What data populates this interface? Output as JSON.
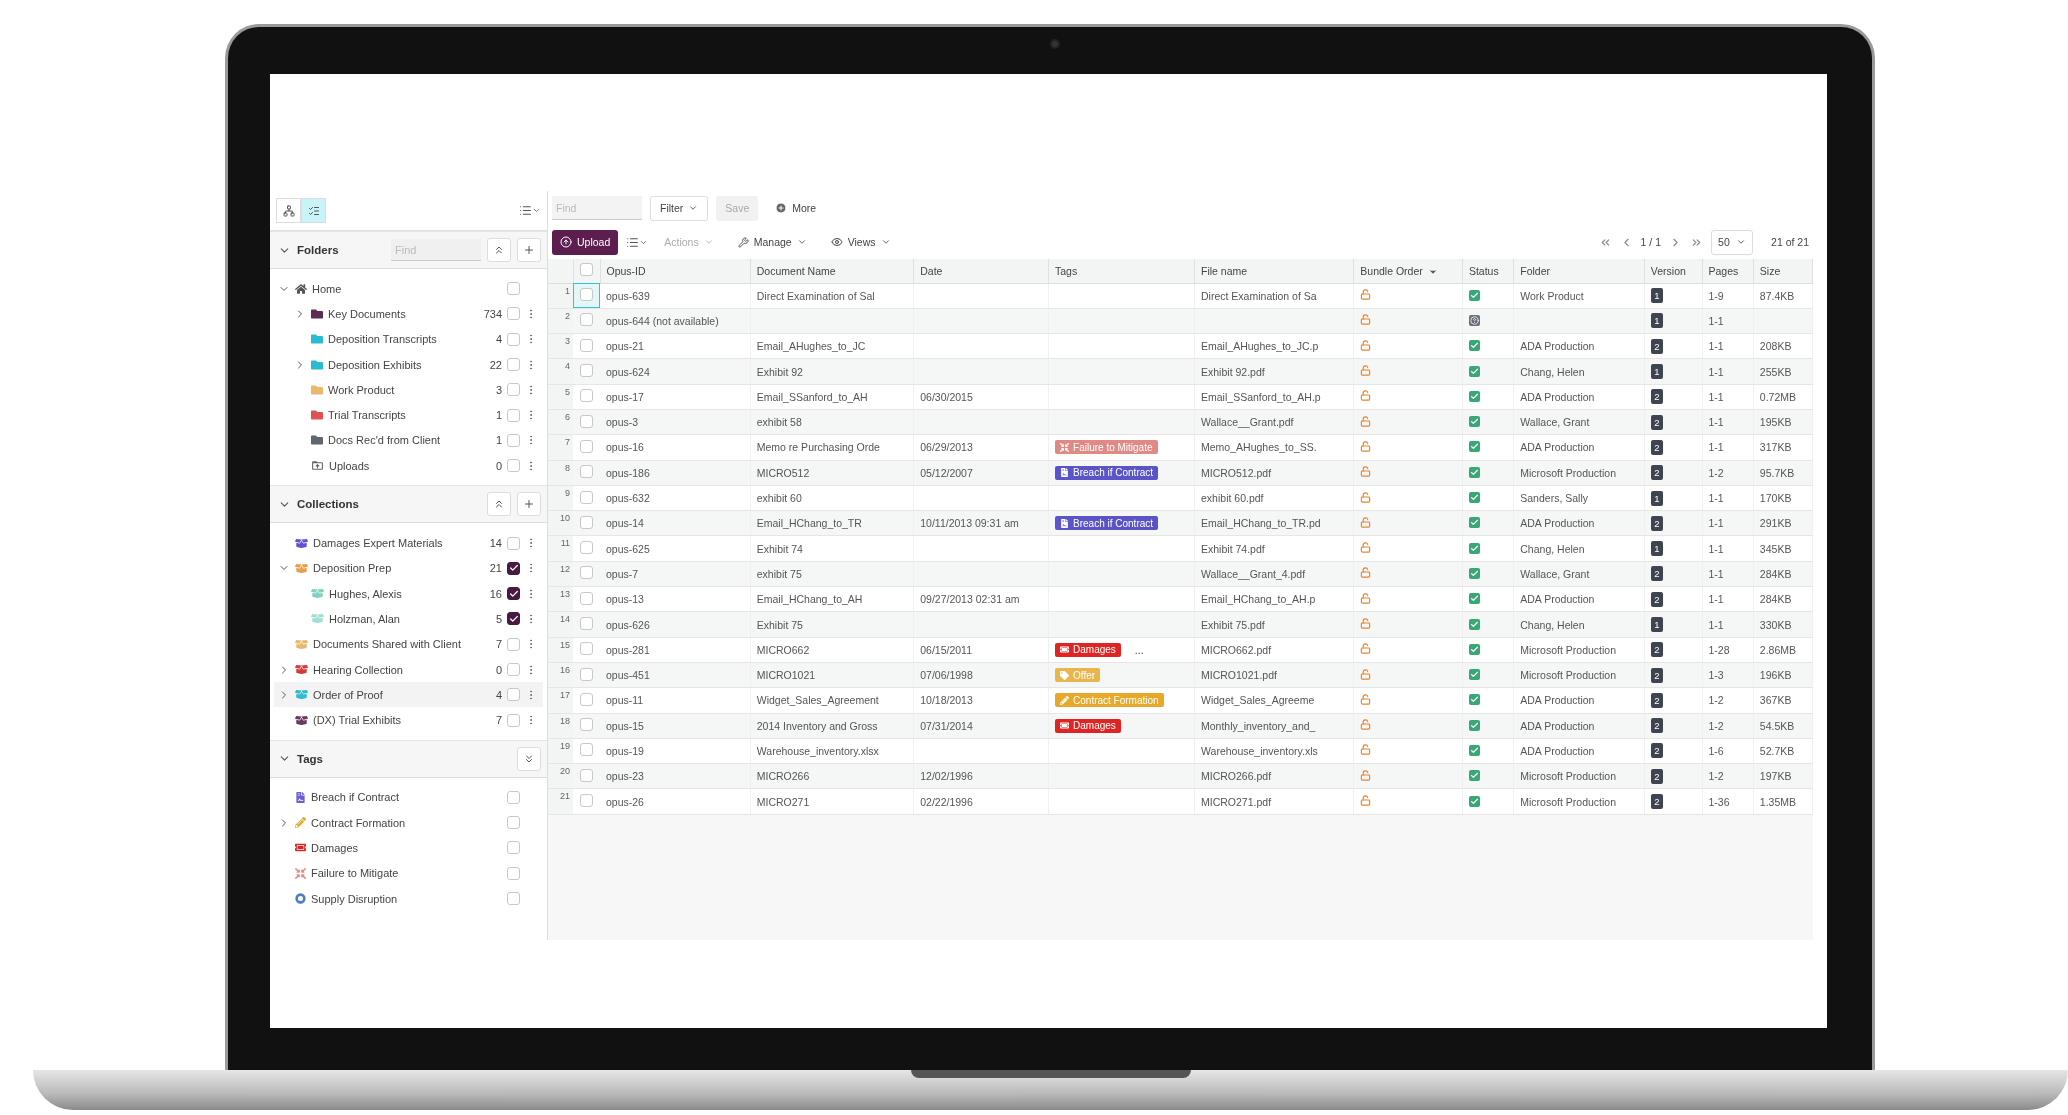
{
  "sidebar": {
    "view_buttons": [
      {
        "kind": "tree",
        "selected": false
      },
      {
        "kind": "list",
        "selected": true
      }
    ],
    "folders": {
      "title": "Folders",
      "expanded": true,
      "find_placeholder": "Find",
      "buttons": [
        {
          "kind": "collapse"
        },
        {
          "kind": "add"
        }
      ],
      "items": [
        {
          "label": "Home",
          "kind": "home",
          "expanded": true,
          "checked": false,
          "children": [
            {
              "label": "Key Documents",
              "kind": "folder",
              "color": "#5c2a55",
              "count": "734",
              "expanded": false,
              "checked": false
            },
            {
              "label": "Deposition Transcripts",
              "kind": "folder",
              "color": "#29bcd0",
              "count": "4",
              "checked": false
            },
            {
              "label": "Deposition Exhibits",
              "kind": "folder",
              "color": "#29bcd0",
              "count": "22",
              "expanded": false,
              "checked": false
            },
            {
              "label": "Work Product",
              "kind": "folder",
              "color": "#e8b96a",
              "count": "3",
              "checked": false
            },
            {
              "label": "Trial Transcripts",
              "kind": "folder",
              "color": "#e05252",
              "count": "1",
              "checked": false
            },
            {
              "label": "Docs Rec'd from Client",
              "kind": "folder",
              "color": "#5f6670",
              "count": "1",
              "checked": false
            },
            {
              "label": "Uploads",
              "kind": "upload",
              "color": "#5f6670",
              "count": "0",
              "checked": false
            }
          ]
        }
      ]
    },
    "collections": {
      "title": "Collections",
      "expanded": true,
      "buttons": [
        {
          "kind": "collapse"
        },
        {
          "kind": "add"
        }
      ],
      "items": [
        {
          "label": "Damages Expert Materials",
          "color": "#6a4fd0",
          "count": "14",
          "checked": false,
          "selected": false
        },
        {
          "label": "Deposition Prep",
          "color": "#e8a04a",
          "count": "21",
          "checked": true,
          "selected": false,
          "expanded": true,
          "children": [
            {
              "label": "Hughes, Alexis",
              "color": "#7fd3c1",
              "count": "16",
              "checked": true,
              "selected": false
            },
            {
              "label": "Holzman, Alan",
              "color": "#9fe0d5",
              "count": "5",
              "checked": true,
              "selected": false
            }
          ]
        },
        {
          "label": "Documents Shared with Client",
          "color": "#e8b96a",
          "count": "7",
          "checked": false,
          "selected": false
        },
        {
          "label": "Hearing Collection",
          "color": "#d83a3a",
          "count": "0",
          "checked": false,
          "selected": false,
          "expanded": false
        },
        {
          "label": "Order of Proof",
          "color": "#29bcd0",
          "count": "4",
          "checked": false,
          "selected": true,
          "expanded": false
        },
        {
          "label": "(DX) Trial Exhibits",
          "color": "#6b3a5e",
          "count": "7",
          "checked": false,
          "selected": false
        }
      ]
    },
    "tags": {
      "title": "Tags",
      "expanded": true,
      "buttons": [
        {
          "kind": "expand"
        }
      ],
      "items": [
        {
          "label": "Breach if Contract",
          "kind": "breach",
          "color": "#6a5fd0",
          "checked": false
        },
        {
          "label": "Contract Formation",
          "kind": "formation",
          "color": "#e8a92a",
          "checked": false,
          "expanded": false
        },
        {
          "label": "Damages",
          "kind": "damages",
          "color": "#e02424",
          "checked": false
        },
        {
          "label": "Failure to Mitigate",
          "kind": "mitigate",
          "color": "#e08a86",
          "checked": false
        },
        {
          "label": "Supply Disruption",
          "kind": "supply",
          "color": "#4a7fc0",
          "checked": false
        }
      ]
    }
  },
  "toolbar": {
    "find_placeholder": "Find",
    "filter": "Filter",
    "save": {
      "label": "Save",
      "disabled": true
    },
    "more": "More"
  },
  "actions_bar": {
    "upload": "Upload",
    "menus": [
      {
        "label": "Actions",
        "kind": "actions",
        "disabled": true
      },
      {
        "label": "Manage",
        "kind": "manage",
        "disabled": false
      },
      {
        "label": "Views",
        "kind": "views",
        "disabled": false
      }
    ]
  },
  "pagination": {
    "page": "1 / 1",
    "page_size": "50",
    "count": "21 of 21"
  },
  "table": {
    "select_all": {
      "checked": false
    },
    "columns": [
      {
        "label": "Opus-ID",
        "sorted": false
      },
      {
        "label": "Document Name",
        "sorted": false
      },
      {
        "label": "Date",
        "sorted": false
      },
      {
        "label": "Tags",
        "sorted": false
      },
      {
        "label": "File name",
        "sorted": false
      },
      {
        "label": "Bundle Order",
        "sorted": true
      },
      {
        "label": "Status",
        "sorted": false
      },
      {
        "label": "Folder",
        "sorted": false
      },
      {
        "label": "Version",
        "sorted": false
      },
      {
        "label": "Pages",
        "sorted": false
      },
      {
        "label": "Size",
        "sorted": false
      }
    ],
    "rows": [
      {
        "num": "1",
        "selected": true,
        "id": "opus-639",
        "name": "Direct Examination of Sal",
        "file": "Direct Examination of Sa",
        "status": {
          "kind": "ok"
        },
        "folder": "Work Product",
        "version": "1",
        "pages": "1-9",
        "size": "87.4KB"
      },
      {
        "num": "2",
        "selected": false,
        "id": "opus-644 (not available)",
        "status": {
          "kind": "unknown"
        },
        "version": "1",
        "pages": "1-1"
      },
      {
        "num": "3",
        "selected": false,
        "id": "opus-21",
        "name": "Email_AHughes_to_JC",
        "file": "Email_AHughes_to_JC.p",
        "status": {
          "kind": "ok"
        },
        "folder": "ADA Production",
        "version": "2",
        "pages": "1-1",
        "size": "208KB"
      },
      {
        "num": "4",
        "selected": false,
        "id": "opus-624",
        "name": "Exhibit 92",
        "file": "Exhibit 92.pdf",
        "status": {
          "kind": "ok"
        },
        "folder": "Chang, Helen",
        "version": "1",
        "pages": "1-1",
        "size": "255KB"
      },
      {
        "num": "5",
        "selected": false,
        "id": "opus-17",
        "name": "Email_SSanford_to_AH",
        "date": "06/30/2015",
        "file": "Email_SSanford_to_AH.p",
        "status": {
          "kind": "ok"
        },
        "folder": "ADA Production",
        "version": "2",
        "pages": "1-1",
        "size": "0.72MB"
      },
      {
        "num": "6",
        "selected": false,
        "id": "opus-3",
        "name": "exhibit 58",
        "file": "Wallace__Grant.pdf",
        "status": {
          "kind": "ok"
        },
        "folder": "Wallace, Grant",
        "version": "2",
        "pages": "1-1",
        "size": "195KB"
      },
      {
        "num": "7",
        "selected": false,
        "id": "opus-16",
        "name": "Memo re Purchasing Orde",
        "date": "06/29/2013",
        "tags": [
          {
            "label": "Failure to Mitigate",
            "kind": "mitigate",
            "color": "#e08a86"
          }
        ],
        "file": "Memo_AHughes_to_SS.",
        "status": {
          "kind": "ok"
        },
        "folder": "ADA Production",
        "version": "2",
        "pages": "1-1",
        "size": "317KB"
      },
      {
        "num": "8",
        "selected": false,
        "id": "opus-186",
        "name": "MICRO512",
        "date": "05/12/2007",
        "tags": [
          {
            "label": "Breach if Contract",
            "kind": "breach",
            "color": "#5b54c9"
          }
        ],
        "file": "MICRO512.pdf",
        "status": {
          "kind": "ok"
        },
        "folder": "Microsoft Production",
        "version": "2",
        "pages": "1-2",
        "size": "95.7KB"
      },
      {
        "num": "9",
        "selected": false,
        "id": "opus-632",
        "name": "exhibit 60",
        "file": "exhibit 60.pdf",
        "status": {
          "kind": "ok"
        },
        "folder": "Sanders, Sally",
        "version": "1",
        "pages": "1-1",
        "size": "170KB"
      },
      {
        "num": "10",
        "selected": false,
        "id": "opus-14",
        "name": "Email_HChang_to_TR",
        "date": "10/11/2013 09:31 am",
        "tags": [
          {
            "label": "Breach if Contract",
            "kind": "breach",
            "color": "#5b54c9"
          }
        ],
        "file": "Email_HChang_to_TR.pd",
        "status": {
          "kind": "ok"
        },
        "folder": "ADA Production",
        "version": "2",
        "pages": "1-1",
        "size": "291KB"
      },
      {
        "num": "11",
        "selected": false,
        "id": "opus-625",
        "name": "Exhibit 74",
        "file": "Exhibit 74.pdf",
        "status": {
          "kind": "ok"
        },
        "folder": "Chang, Helen",
        "version": "1",
        "pages": "1-1",
        "size": "345KB"
      },
      {
        "num": "12",
        "selected": false,
        "id": "opus-7",
        "name": "exhibit 75",
        "file": "Wallace__Grant_4.pdf",
        "status": {
          "kind": "ok"
        },
        "folder": "Wallace, Grant",
        "version": "2",
        "pages": "1-1",
        "size": "284KB"
      },
      {
        "num": "13",
        "selected": false,
        "id": "opus-13",
        "name": "Email_HChang_to_AH",
        "date": "09/27/2013 02:31 am",
        "file": "Email_HChang_to_AH.p",
        "status": {
          "kind": "ok"
        },
        "folder": "ADA Production",
        "version": "2",
        "pages": "1-1",
        "size": "284KB"
      },
      {
        "num": "14",
        "selected": false,
        "id": "opus-626",
        "name": "Exhibit 75",
        "file": "Exhibit 75.pdf",
        "status": {
          "kind": "ok"
        },
        "folder": "Chang, Helen",
        "version": "1",
        "pages": "1-1",
        "size": "330KB"
      },
      {
        "num": "15",
        "selected": false,
        "id": "opus-281",
        "name": "MICRO662",
        "date": "06/15/2011",
        "tags": [
          {
            "label": "Damages",
            "kind": "damages",
            "color": "#e02424"
          }
        ],
        "more": "...",
        "file": "MICRO662.pdf",
        "status": {
          "kind": "ok"
        },
        "folder": "Microsoft Production",
        "version": "2",
        "pages": "1-28",
        "size": "2.86MB"
      },
      {
        "num": "16",
        "selected": false,
        "id": "opus-451",
        "name": "MICRO1021",
        "date": "07/06/1998",
        "tags": [
          {
            "label": "Offer",
            "kind": "offer",
            "color": "#e8b64c"
          }
        ],
        "file": "MICRO1021.pdf",
        "status": {
          "kind": "ok"
        },
        "folder": "Microsoft Production",
        "version": "2",
        "pages": "1-3",
        "size": "196KB"
      },
      {
        "num": "17",
        "selected": false,
        "id": "opus-11",
        "name": "Widget_Sales_Agreement",
        "date": "10/18/2013",
        "tags": [
          {
            "label": "Contract Formation",
            "kind": "formation",
            "color": "#e8a92a"
          }
        ],
        "file": "Widget_Sales_Agreeme",
        "status": {
          "kind": "ok"
        },
        "folder": "ADA Production",
        "version": "2",
        "pages": "1-2",
        "size": "367KB"
      },
      {
        "num": "18",
        "selected": false,
        "id": "opus-15",
        "name": "2014 Inventory and Gross",
        "date": "07/31/2014",
        "tags": [
          {
            "label": "Damages",
            "kind": "damages",
            "color": "#e02424"
          }
        ],
        "file": "Monthly_inventory_and_",
        "status": {
          "kind": "ok"
        },
        "folder": "ADA Production",
        "version": "2",
        "pages": "1-2",
        "size": "54.5KB"
      },
      {
        "num": "19",
        "selected": false,
        "id": "opus-19",
        "name": "Warehouse_inventory.xlsx",
        "file": "Warehouse_inventory.xls",
        "status": {
          "kind": "ok"
        },
        "folder": "ADA Production",
        "version": "2",
        "pages": "1-6",
        "size": "52.7KB"
      },
      {
        "num": "20",
        "selected": false,
        "id": "opus-23",
        "name": "MICRO266",
        "date": "12/02/1996",
        "file": "MICRO266.pdf",
        "status": {
          "kind": "ok"
        },
        "folder": "Microsoft Production",
        "version": "2",
        "pages": "1-2",
        "size": "197KB"
      },
      {
        "num": "21",
        "selected": false,
        "id": "opus-26",
        "name": "MICRO271",
        "date": "02/22/1996",
        "file": "MICRO271.pdf",
        "status": {
          "kind": "ok"
        },
        "folder": "Microsoft Production",
        "version": "2",
        "pages": "1-36",
        "size": "1.35MB"
      }
    ]
  }
}
